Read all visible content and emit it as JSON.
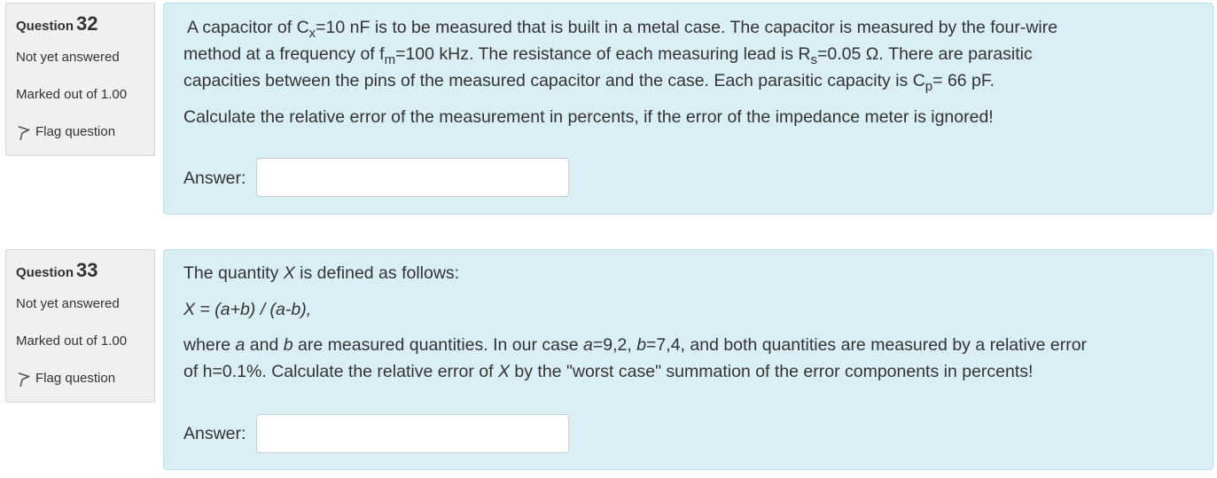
{
  "questions": [
    {
      "label": "Question",
      "number": "32",
      "state": "Not yet answered",
      "grade": "Marked out of 1.00",
      "flag_label": "Flag question",
      "text": {
        "p1_a": "A capacitor of C",
        "p1_sub_x": "x",
        "p1_b": "=10 nF is to be measured that is built in a metal case. The capacitor is measured by the four-wire",
        "p2_a": "method at a frequency of f",
        "p2_sub_m": "m",
        "p2_b": "=100 kHz. The resistance of each measuring lead is R",
        "p2_sub_s": "s",
        "p2_c": "=0.05 Ω. There are parasitic",
        "p3_a": "capacities between the pins of the measured capacitor and the case. Each parasitic capacity is C",
        "p3_sub_p": "p",
        "p3_b": "= 66 pF.",
        "p4": "Calculate the relative error of the measurement in percents, if the error of the impedance meter is ignored!"
      },
      "answer_label": "Answer:",
      "answer_value": ""
    },
    {
      "label": "Question",
      "number": "33",
      "state": "Not yet answered",
      "grade": "Marked out of 1.00",
      "flag_label": "Flag question",
      "text": {
        "l1_a": "The quantity ",
        "l1_x": "X",
        "l1_b": " is defined as follows:",
        "l2": "X = (a+b) / (a-b),",
        "l3_a": "where ",
        "l3_va": "a",
        "l3_b": " and ",
        "l3_vb": "b",
        "l3_c": " are measured quantities. In our case ",
        "l3_va2": "a",
        "l3_d": "=9,2, ",
        "l3_vb2": "b",
        "l3_e": "=7,4, and both quantities are measured by a relative error",
        "l4_a": "of h=0.1%. Calculate the relative error of ",
        "l4_x": "X",
        "l4_b": " by the \"worst case\" summation of the error components in percents!"
      },
      "answer_label": "Answer:",
      "answer_value": ""
    }
  ],
  "colors": {
    "content_bg": "#daeef6",
    "content_border": "#b9e0ef",
    "info_bg": "#f0f0f0",
    "text": "#333333"
  },
  "icons": {
    "flag": "flag-icon"
  }
}
